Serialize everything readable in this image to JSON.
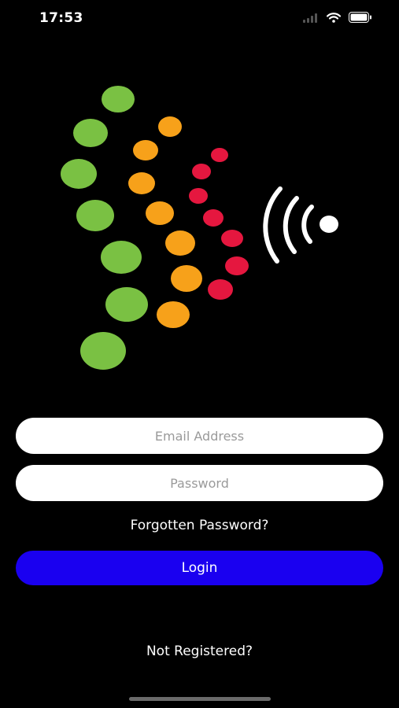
{
  "status_bar": {
    "time": "17:53",
    "icons": [
      "cellular-signal-icon",
      "wifi-icon",
      "battery-icon"
    ]
  },
  "logo": {
    "icon": "contactless-dots-logo-icon",
    "colors": {
      "green": "#7ac143",
      "orange": "#f7a11a",
      "red": "#e5173f",
      "waves": "#ffffff"
    }
  },
  "login_form": {
    "email_placeholder": "Email Address",
    "password_placeholder": "Password",
    "forgot_password_label": "Forgotten Password?",
    "login_label": "Login",
    "not_registered_label": "Not Registered?"
  },
  "colors": {
    "background": "#000000",
    "login_button": "#1a00f0",
    "field_background": "#ffffff"
  }
}
